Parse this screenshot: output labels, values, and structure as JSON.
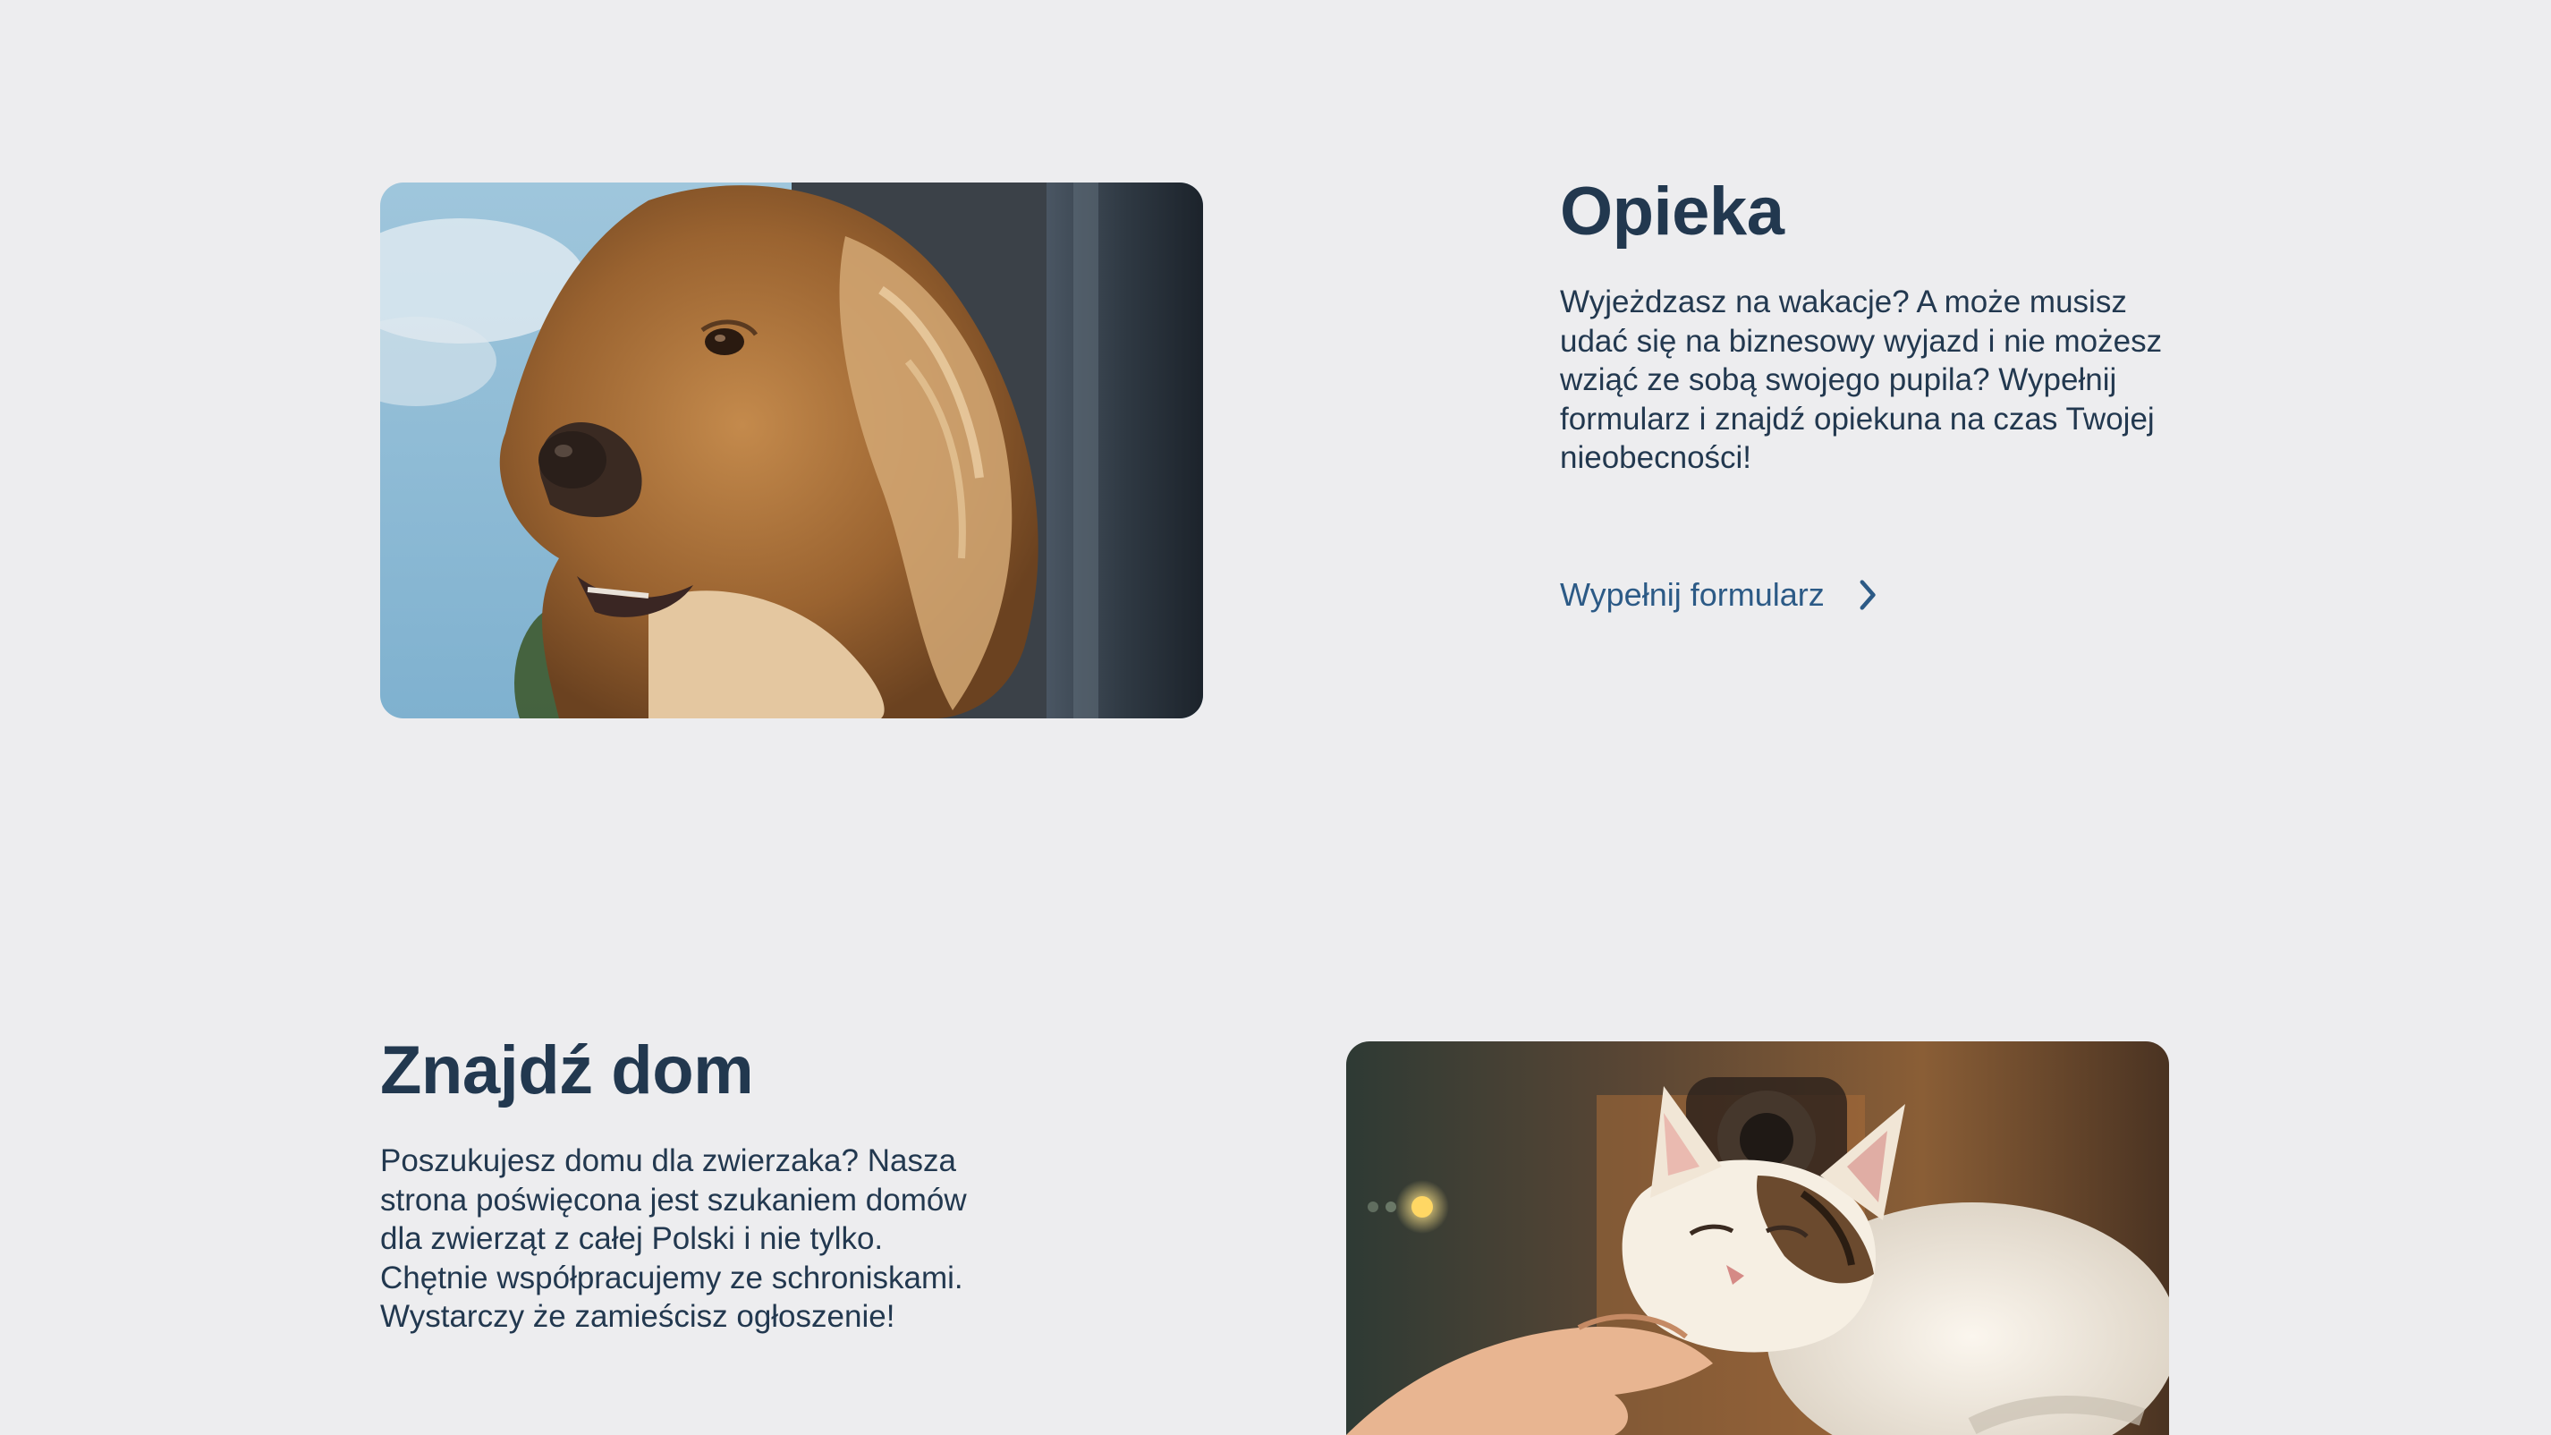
{
  "sections": [
    {
      "id": "opieka",
      "title": "Opieka",
      "description": "Wyjeżdzasz na wakacje? A może musisz udać się na biznesowy wyjazd i nie możesz wziąć ze sobą swojego pupila? Wypełnij formularz i znajdź opiekuna na czas Twojej nieobecności!",
      "cta_label": "Wypełnij formularz",
      "cta_icon": "chevron-right-icon",
      "image": "dog-photo"
    },
    {
      "id": "znajdz-dom",
      "title": "Znajdź dom",
      "description_lines": [
        "Poszukujesz domu dla zwierzaka? Nasza",
        "strona poświęcona jest szukaniem domów",
        "dla zwierząt z całej Polski i nie tylko.",
        "Chętnie współpracujemy ze schroniskami.",
        "Wystarczy że zamieścisz ogłoszenie!"
      ],
      "image": "cat-photo"
    }
  ],
  "colors": {
    "background": "#ededef",
    "heading": "#22384f",
    "link": "#2c5a86"
  }
}
